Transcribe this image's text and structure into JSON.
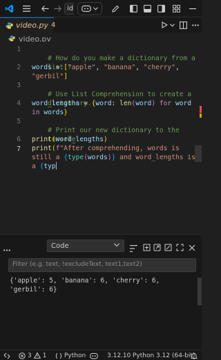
{
  "titlebar": {
    "search_fragment": "id",
    "colors": {
      "vscode_blue": "#0098ff",
      "background": "#181818"
    }
  },
  "tab": {
    "filename": "video.py",
    "problem_count": "4"
  },
  "breadcrumb": {
    "filename": "video.py"
  },
  "editor": {
    "line_numbers": [
      "1",
      "2",
      "3",
      "4",
      "5",
      "6",
      "7"
    ],
    "active_line": "7",
    "code": {
      "l1a": "# How do you make a dictionary from a",
      "l1b": "list ?",
      "l2_var": "words",
      "l2_eq": " = ",
      "l2_s1": "\"apple\"",
      "l2_s2": "\"banana\"",
      "l2_s3": "\"cherry\"",
      "l2_s4": "\"gerbil\"",
      "l3a": "# Use List Comprehension to create a",
      "l3b": "dictionary...",
      "l4_var": "word_lengths",
      "l4_key": "word",
      "l4_fn": "len",
      "l4_arg": "word",
      "l4_for": "for",
      "l4_item": "word",
      "l4_in": "in",
      "l4_src": "words",
      "l5a": "# Print our new dictionary to the",
      "l5b": "console...",
      "l6_fn": "print",
      "l6_arg": "word_lengths",
      "l7_fn": "print",
      "l7_prefix": "f",
      "l7_s1": "\"After comprehending, words is",
      "l7_s2": "still a ",
      "l7_type1": "type",
      "l7_arg1": "words",
      "l7_s3": " and word_lengths is",
      "l7_s4": "a ",
      "l7_type2": "typ"
    }
  },
  "panel": {
    "output_channel": "Code",
    "filter_placeholder": "Filter (e.g. text, !excludeText, text1,text2)",
    "output_line": "{'apple': 5, 'banana': 6, 'cherry': 6, 'gerbil': 6}"
  },
  "statusbar": {
    "errors": "3",
    "warnings": "1",
    "language": "Python",
    "python_version": "3.12.10",
    "interpreter": "Python 3.12 (64-bit)"
  }
}
